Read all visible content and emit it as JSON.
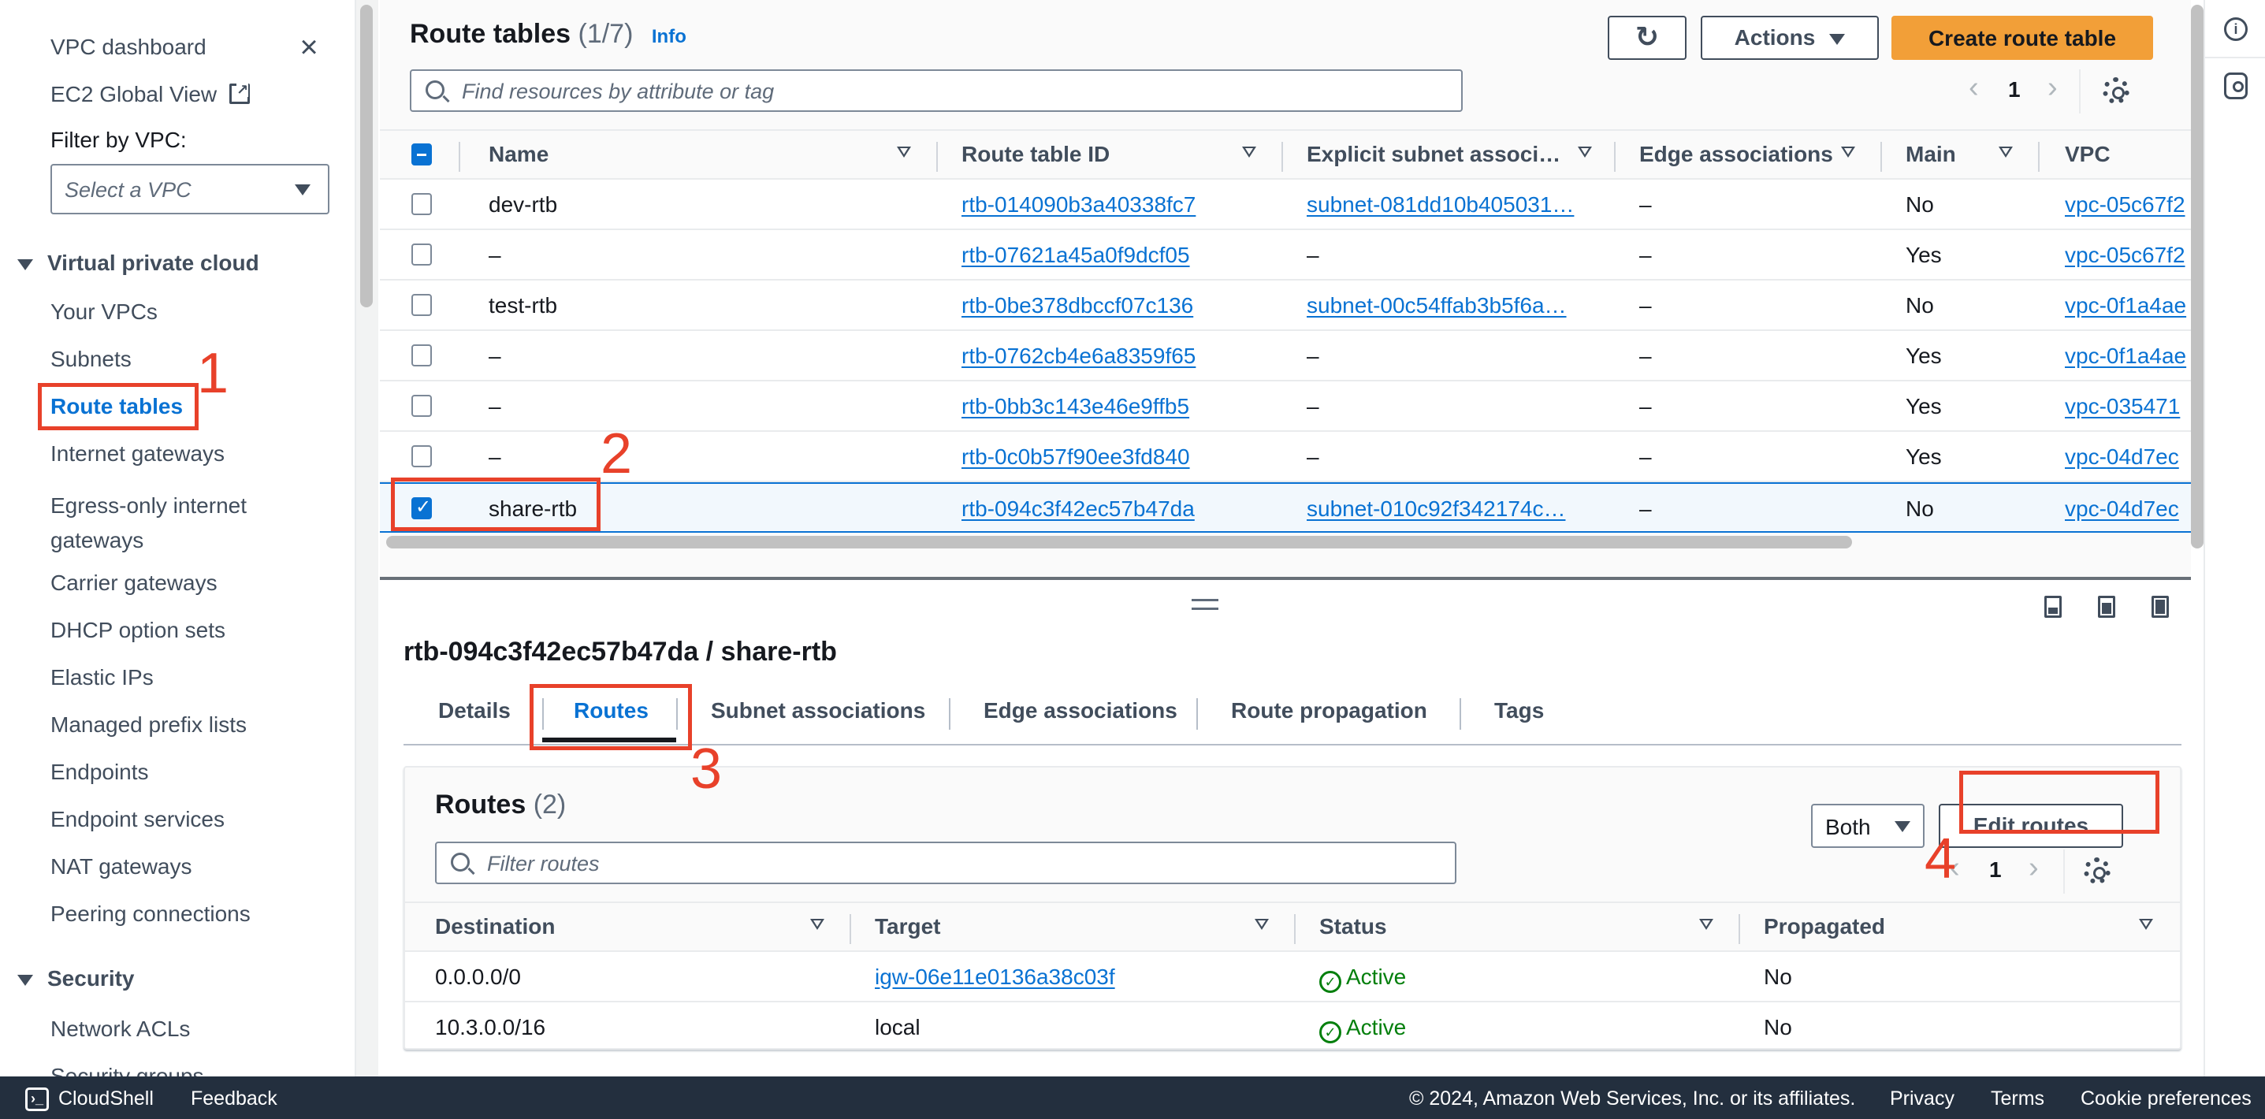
{
  "sidebar": {
    "dashboard": "VPC dashboard",
    "global_view": "EC2 Global View",
    "filter_label": "Filter by VPC:",
    "filter_placeholder": "Select a VPC",
    "sections": [
      {
        "title": "Virtual private cloud",
        "items": [
          {
            "label": "Your VPCs"
          },
          {
            "label": "Subnets"
          },
          {
            "label": "Route tables",
            "active": true
          },
          {
            "label": "Internet gateways"
          },
          {
            "label": "Egress-only internet gateways"
          },
          {
            "label": "Carrier gateways"
          },
          {
            "label": "DHCP option sets"
          },
          {
            "label": "Elastic IPs"
          },
          {
            "label": "Managed prefix lists"
          },
          {
            "label": "Endpoints"
          },
          {
            "label": "Endpoint services"
          },
          {
            "label": "NAT gateways"
          },
          {
            "label": "Peering connections"
          }
        ]
      },
      {
        "title": "Security",
        "items": [
          {
            "label": "Network ACLs"
          },
          {
            "label": "Security groups"
          }
        ]
      }
    ]
  },
  "route_tables": {
    "title": "Route tables",
    "count": "(1/7)",
    "info": "Info",
    "refresh_icon": "refresh-icon",
    "actions_label": "Actions",
    "create_label": "Create route table",
    "search_placeholder": "Find resources by attribute or tag",
    "page": "1",
    "columns": [
      "Name",
      "Route table ID",
      "Explicit subnet associ…",
      "Edge associations",
      "Main",
      "VPC"
    ],
    "rows": [
      {
        "name": "dev-rtb",
        "id": "rtb-014090b3a40338fc7",
        "subnet": "subnet-081dd10b405031…",
        "edge": "–",
        "main": "No",
        "vpc": "vpc-05c67f2",
        "selected": false
      },
      {
        "name": "–",
        "id": "rtb-07621a45a0f9dcf05",
        "subnet": "–",
        "edge": "–",
        "main": "Yes",
        "vpc": "vpc-05c67f2",
        "selected": false
      },
      {
        "name": "test-rtb",
        "id": "rtb-0be378dbccf07c136",
        "subnet": "subnet-00c54ffab3b5f6a…",
        "edge": "–",
        "main": "No",
        "vpc": "vpc-0f1a4ae",
        "selected": false
      },
      {
        "name": "–",
        "id": "rtb-0762cb4e6a8359f65",
        "subnet": "–",
        "edge": "–",
        "main": "Yes",
        "vpc": "vpc-0f1a4ae",
        "selected": false
      },
      {
        "name": "–",
        "id": "rtb-0bb3c143e46e9ffb5",
        "subnet": "–",
        "edge": "–",
        "main": "Yes",
        "vpc": "vpc-035471",
        "selected": false
      },
      {
        "name": "–",
        "id": "rtb-0c0b57f90ee3fd840",
        "subnet": "–",
        "edge": "–",
        "main": "Yes",
        "vpc": "vpc-04d7ec",
        "selected": false
      },
      {
        "name": "share-rtb",
        "id": "rtb-094c3f42ec57b47da",
        "subnet": "subnet-010c92f342174c…",
        "edge": "–",
        "main": "No",
        "vpc": "vpc-04d7ec",
        "selected": true
      }
    ]
  },
  "detail": {
    "title": "rtb-094c3f42ec57b47da / share-rtb",
    "tabs": [
      {
        "label": "Details"
      },
      {
        "label": "Routes",
        "active": true
      },
      {
        "label": "Subnet associations"
      },
      {
        "label": "Edge associations"
      },
      {
        "label": "Route propagation"
      },
      {
        "label": "Tags"
      }
    ],
    "routes": {
      "title": "Routes",
      "count": "(2)",
      "filter_value": "Both",
      "edit_label": "Edit routes",
      "search_placeholder": "Filter routes",
      "page": "1",
      "columns": [
        "Destination",
        "Target",
        "Status",
        "Propagated"
      ],
      "rows": [
        {
          "destination": "0.0.0.0/0",
          "target": "igw-06e11e0136a38c03f",
          "target_link": true,
          "status": "Active",
          "propagated": "No"
        },
        {
          "destination": "10.3.0.0/16",
          "target": "local",
          "target_link": false,
          "status": "Active",
          "propagated": "No"
        }
      ]
    }
  },
  "annotations": [
    "1",
    "2",
    "3",
    "4"
  ],
  "footer": {
    "cloudshell": "CloudShell",
    "feedback": "Feedback",
    "copyright": "© 2024, Amazon Web Services, Inc. or its affiliates.",
    "privacy": "Privacy",
    "terms": "Terms",
    "cookies": "Cookie preferences"
  },
  "colors": {
    "accent": "#0972d3",
    "primary_button": "#f29f38",
    "annotation": "#e8412a",
    "status_ok": "#037f0c",
    "footer_bg": "#232f3e"
  }
}
